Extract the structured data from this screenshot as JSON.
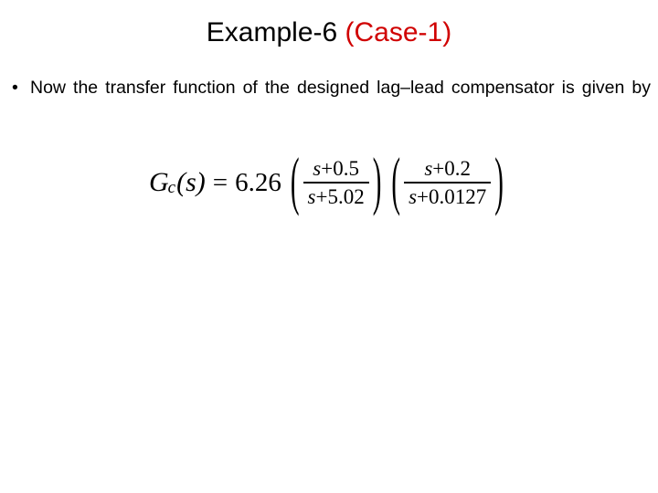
{
  "slide": {
    "title": {
      "main": "Example-6 ",
      "accent": "(Case-1)",
      "accent_color": "#D00000",
      "text_color": "#000000"
    },
    "background_color": "#FFFFFF",
    "bullets": [
      {
        "marker": "•",
        "text": "Now the transfer function of the designed lag–lead compensator is given by"
      }
    ],
    "equation": {
      "plain_text": "G_c(s) = 6.26 ((s+0.5)/(s+5.02)) ((s+0.2)/(s+0.0127))",
      "lhs_var": "G",
      "lhs_subscript": "c",
      "lhs_arg": "(s)",
      "equals": "=",
      "gain": "6.26",
      "factors": [
        {
          "open_paren": "(",
          "numerator": {
            "var": "s",
            "rest": "+0.5"
          },
          "denominator": {
            "var": "s",
            "rest": "+5.02"
          },
          "close_paren": ")"
        },
        {
          "open_paren": "(",
          "numerator": {
            "var": "s",
            "rest": "+0.2"
          },
          "denominator": {
            "var": "s",
            "rest": "+0.0127"
          },
          "close_paren": ")"
        }
      ]
    }
  }
}
